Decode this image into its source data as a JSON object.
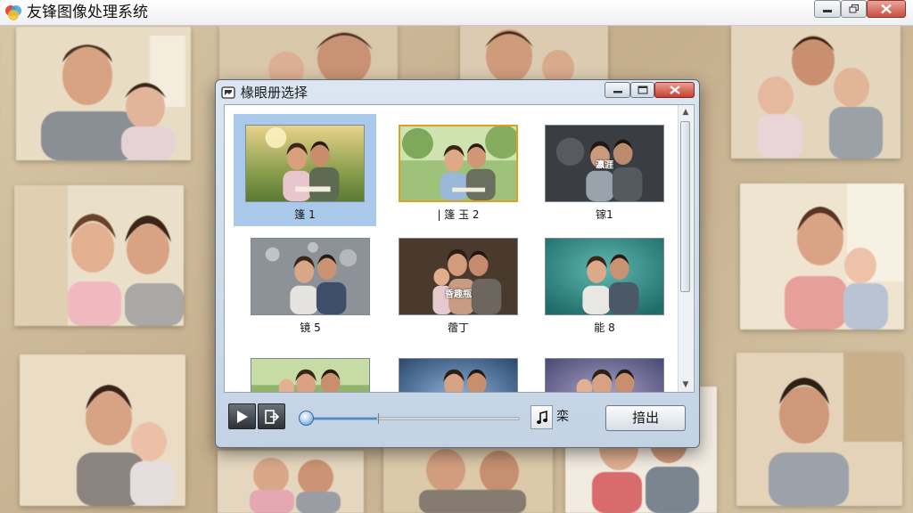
{
  "app": {
    "title": "友锋图像处理系统",
    "icon": "app-logo-icon"
  },
  "window_controls": [
    "minimize-icon",
    "restore-icon",
    "close-icon"
  ],
  "dialog": {
    "title": "椽眼册选择",
    "icon": "album-icon",
    "controls": [
      "minimize-icon",
      "maximize-icon",
      "close-icon"
    ]
  },
  "thumbnails": [
    {
      "caption": "篷 1",
      "selected": true,
      "scene": "park-sunset"
    },
    {
      "caption": "| 篷 玉 2",
      "focus": true,
      "scene": "park-green"
    },
    {
      "caption": "镓1",
      "scene": "dark-studio",
      "overlay": "瀛涯"
    },
    {
      "caption": "镜 5",
      "scene": "bokeh-gray"
    },
    {
      "caption": "蓿丁",
      "scene": "dark-brown",
      "overlay": "昏趣瓶"
    },
    {
      "caption": "能 8",
      "scene": "teal-studio"
    },
    {
      "caption": "",
      "scene": "park-green"
    },
    {
      "caption": "",
      "scene": "blue-studio"
    },
    {
      "caption": "",
      "scene": "purple-studio"
    }
  ],
  "toolbar": {
    "play_icon": "play-icon",
    "export_frame_icon": "frame-export-icon",
    "slider_progress": 0.32,
    "music_icon": "music-note-icon",
    "music_label": "栾",
    "export_label": "揞出"
  },
  "colors": {
    "selection": "#a9c8ea",
    "focus_border": "#d9a227",
    "accent": "#3a8fe0"
  }
}
